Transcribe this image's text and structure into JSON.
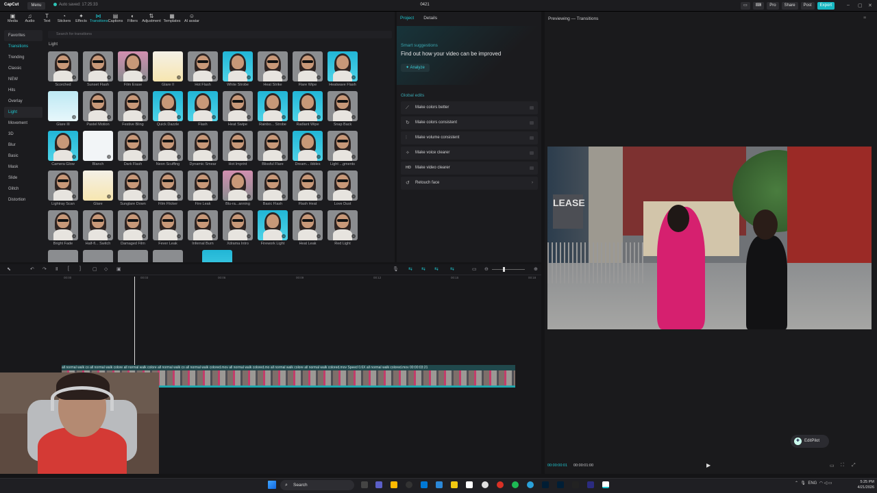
{
  "app": {
    "logo": "CapCut",
    "menu": "Menu",
    "autosave": "Auto saved: 17:25:33",
    "project_name": "0421",
    "buttons": [
      "Pro",
      "Share",
      "Post",
      "Export"
    ]
  },
  "tooltabs": [
    {
      "label": "Media",
      "icon": "media-icon"
    },
    {
      "label": "Audio",
      "icon": "audio-icon"
    },
    {
      "label": "Text",
      "icon": "text-icon"
    },
    {
      "label": "Stickers",
      "icon": "stickers-icon"
    },
    {
      "label": "Effects",
      "icon": "effects-icon"
    },
    {
      "label": "Transitions",
      "icon": "transitions-icon",
      "active": true
    },
    {
      "label": "Captions",
      "icon": "captions-icon"
    },
    {
      "label": "Filters",
      "icon": "filters-icon"
    },
    {
      "label": "Adjustment",
      "icon": "adjustment-icon"
    },
    {
      "label": "Templates",
      "icon": "templates-icon"
    },
    {
      "label": "AI avatar",
      "icon": "ai-avatar-icon"
    }
  ],
  "categories": [
    "Favorites",
    "Transitions",
    "Trending",
    "Classic",
    "NEW",
    "Hits",
    "Overlay",
    "Light",
    "Movement",
    "3D",
    "Blur",
    "Basic",
    "Mask",
    "Slide",
    "Glitch",
    "Distortion"
  ],
  "active_category": "Light",
  "search_placeholder": "Search for transitions",
  "section_title": "Light",
  "thumbnails": [
    [
      "Scorched",
      "Sunset Flash",
      "Film Erase",
      "Glare II",
      "Hot Flash",
      "White Strobe",
      "Heat Strike",
      "Flare Wipe",
      "Heatwave Flash"
    ],
    [
      "Glare III",
      "Pastel Motion",
      "Festive Bling",
      "Quick Dazzle",
      "Flash",
      "Heat Swipe",
      "Rainbo... Strobe",
      "Radiant Wipe",
      "Snap Back"
    ],
    [
      "Camera Glow",
      "Blanch",
      "Dark Flash",
      "Neon Scuffing",
      "Dynamic Smear",
      "Hot Imprint",
      "Blissful Flare",
      "Dream... ibbles",
      "Light ...gments"
    ],
    [
      "Lightray Scan",
      "Glare",
      "Sunglare Down",
      "Film Flicker",
      "Fire Leak",
      "Blu-ra...anning",
      "Basic Flash",
      "Flash Heat",
      "Love Dust"
    ],
    [
      "Bright Fade",
      "Half-fl... Switch",
      "Damaged Film",
      "Fever Leak",
      "Infernal Burn",
      "Xdrama Intro",
      "Firework Light",
      "Heat Leak",
      "Red Light"
    ]
  ],
  "project": {
    "tabs": [
      "Project",
      "Details"
    ],
    "smart_title": "Smart suggestions",
    "smart_headline": "Find out how your video can be improved",
    "analyze": "Analyze",
    "global_title": "Global edits",
    "items": [
      {
        "label": "Make colors better",
        "icon": "magic-wand-icon"
      },
      {
        "label": "Make colors consistent",
        "icon": "color-sync-icon"
      },
      {
        "label": "Make volume consistent",
        "icon": "volume-bars-icon"
      },
      {
        "label": "Make voice clearer",
        "icon": "voice-icon"
      },
      {
        "label": "Make video clearer",
        "icon": "hd-icon",
        "icon_text": "HD"
      },
      {
        "label": "Retouch face",
        "icon": "retouch-icon"
      }
    ]
  },
  "preview": {
    "title": "Previewing — Transitions",
    "video_sign": "LEASE",
    "editpilot": "EditPilot",
    "time_current": "00:00:00:01",
    "time_total": "00:00:01:00"
  },
  "timeline": {
    "ruler": [
      "00:00",
      "00:03",
      "00:06",
      "00:09",
      "00:12",
      "00:15",
      "00:18"
    ],
    "clip_labels": "all normal walk co  all normal walk colore  all normal walk colore  all normal walk co  all normal walk colored.mov  all normal walk colored.mo  all normal walk colore  all normal walk colored.mov  Speed 0.6X  all normal walk colored.mov  00:00:03:21"
  },
  "taskbar": {
    "search": "Search",
    "tray_lang": "ENG",
    "time": "5:25 PM",
    "date": "4/21/2026"
  }
}
